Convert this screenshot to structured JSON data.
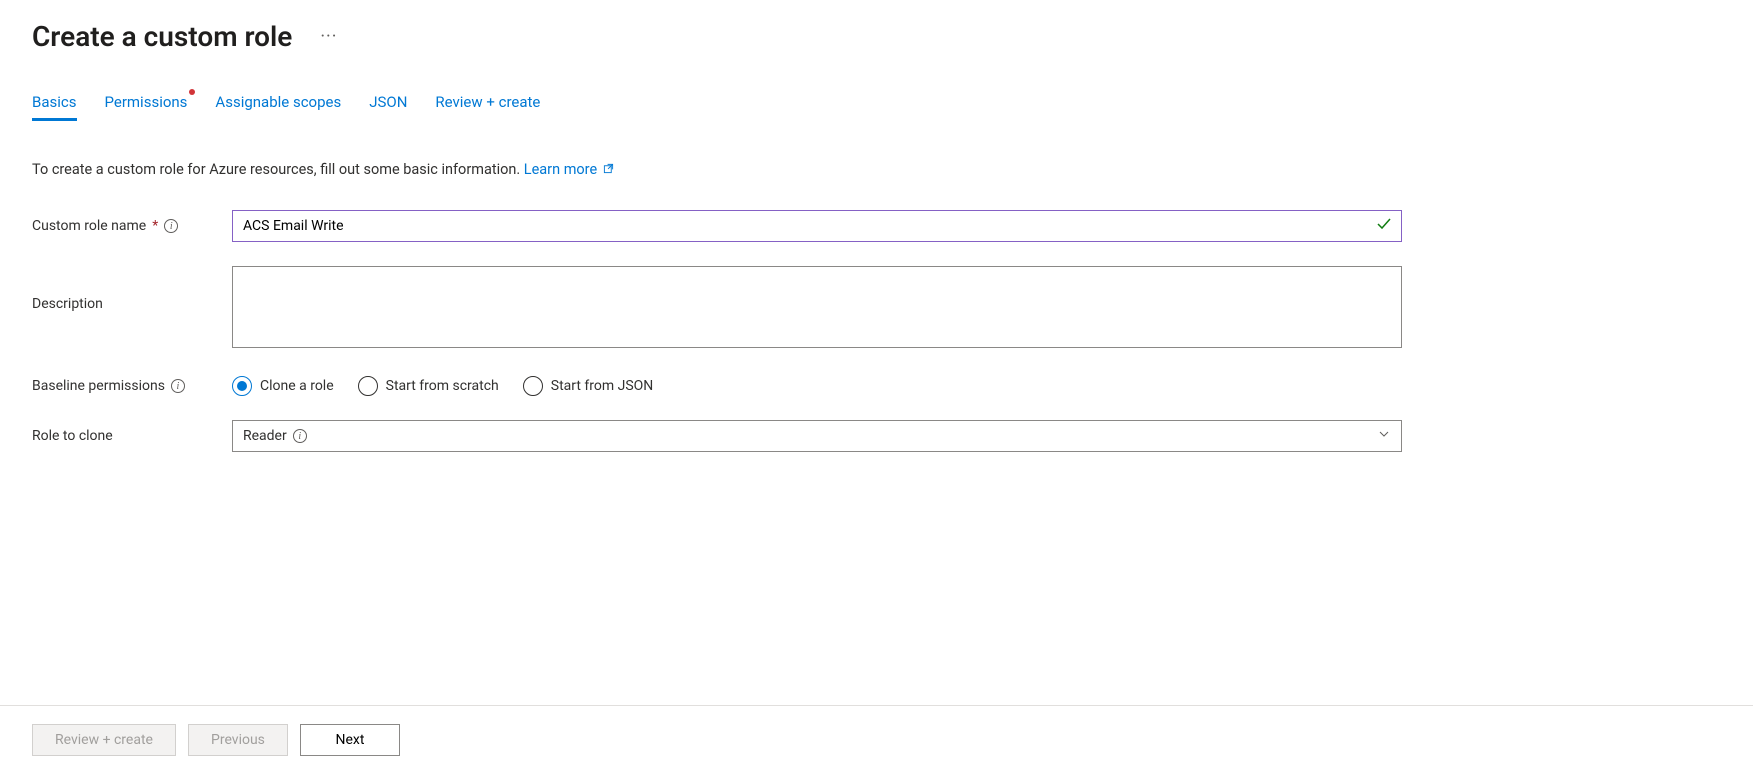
{
  "header": {
    "title": "Create a custom role"
  },
  "tabs": [
    {
      "label": "Basics",
      "active": true
    },
    {
      "label": "Permissions",
      "active": false,
      "hasDot": true
    },
    {
      "label": "Assignable scopes",
      "active": false
    },
    {
      "label": "JSON",
      "active": false
    },
    {
      "label": "Review + create",
      "active": false
    }
  ],
  "intro": {
    "text": "To create a custom role for Azure resources, fill out some basic information. ",
    "linkText": "Learn more"
  },
  "form": {
    "roleName": {
      "label": "Custom role name",
      "value": "ACS Email Write"
    },
    "description": {
      "label": "Description",
      "value": ""
    },
    "baseline": {
      "label": "Baseline permissions",
      "options": {
        "clone": "Clone a role",
        "scratch": "Start from scratch",
        "json": "Start from JSON"
      },
      "selected": "clone"
    },
    "roleToClone": {
      "label": "Role to clone",
      "value": "Reader"
    }
  },
  "footer": {
    "reviewCreate": "Review + create",
    "previous": "Previous",
    "next": "Next"
  }
}
